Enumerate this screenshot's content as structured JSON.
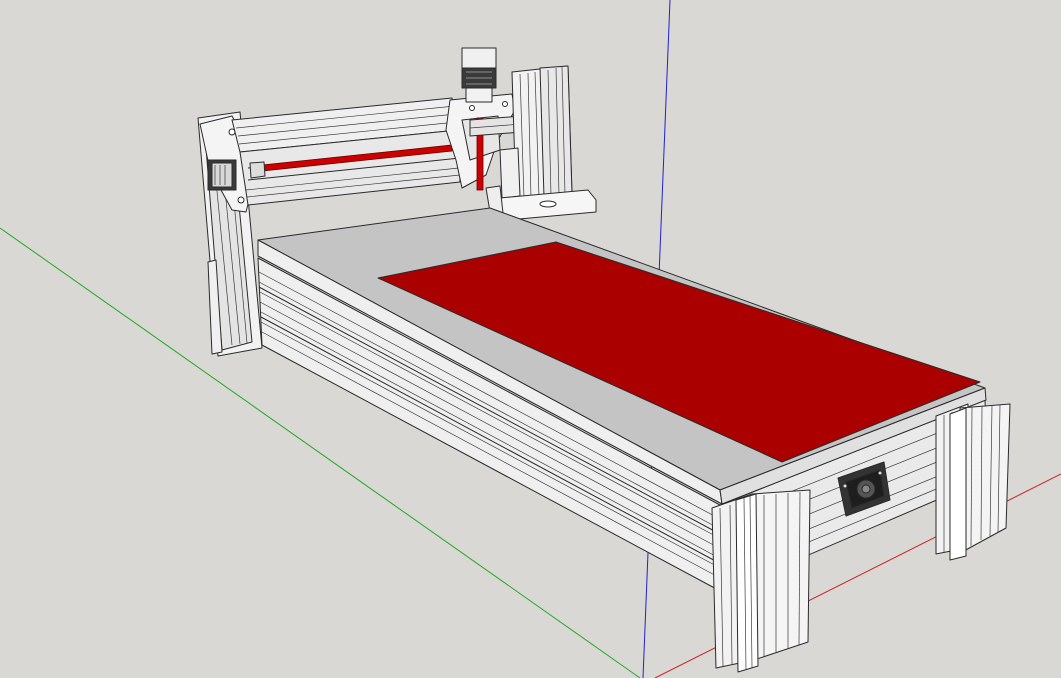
{
  "app": {
    "view": "3d-model-viewport",
    "model": "cnc-router-frame"
  },
  "axes": {
    "x_color": "#cc2222",
    "y_color": "#22aa22",
    "z_color": "#2222cc"
  },
  "colors": {
    "background": "#d9d8d5",
    "spoilboard": "#aa0000",
    "bed": "#c4c4c4",
    "extrusion": "#f2f2f2",
    "edge": "#2a2a2a",
    "motor": "#3a3a3a"
  }
}
